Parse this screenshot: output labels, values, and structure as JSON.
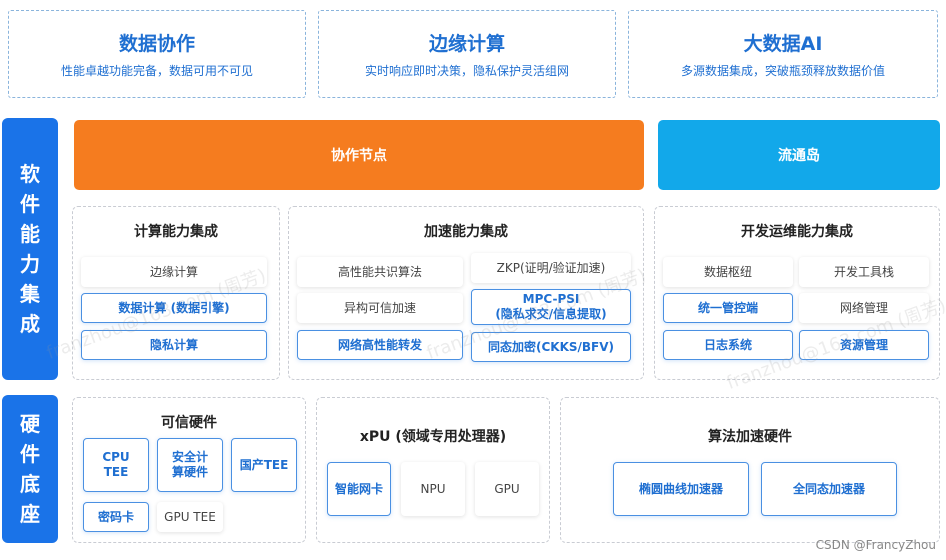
{
  "top": [
    {
      "title": "数据协作",
      "subtitle": "性能卓越功能完备，数据可用不可见"
    },
    {
      "title": "边缘计算",
      "subtitle": "实时响应即时决策，隐私保护灵活组网"
    },
    {
      "title": "大数据AI",
      "subtitle": "多源数据集成，突破瓶颈释放数据价值"
    }
  ],
  "sidebar": {
    "software": "软件能力集成",
    "hardware": "硬件底座"
  },
  "bars": {
    "node": "协作节点",
    "island": "流通岛"
  },
  "compute": {
    "title": "计算能力集成",
    "items": [
      "边缘计算",
      "数据计算 (数据引擎)",
      "隐私计算"
    ]
  },
  "accel": {
    "title": "加速能力集成",
    "left": [
      "高性能共识算法",
      "异构可信加速",
      "网络高性能转发"
    ],
    "zkp": "ZKP(证明/验证加速)",
    "mpc1": "MPC-PSI",
    "mpc2": "(隐私求交/信息提取)",
    "he": "同态加密(CKKS/BFV)"
  },
  "devops": {
    "title": "开发运维能力集成",
    "items": [
      "数据枢纽",
      "开发工具栈",
      "统一管控端",
      "网络管理",
      "日志系统",
      "资源管理"
    ]
  },
  "trusted": {
    "title": "可信硬件",
    "cpu1": "CPU",
    "cpu2": "TEE",
    "sec1": "安全计",
    "sec2": "算硬件",
    "domestic": "国产TEE",
    "crypto": "密码卡",
    "gpu_tee": "GPU TEE"
  },
  "xpu": {
    "title": "xPU (领域专用处理器)",
    "items": [
      "智能网卡",
      "NPU",
      "GPU"
    ]
  },
  "algo": {
    "title": "算法加速硬件",
    "items": [
      "椭圆曲线加速器",
      "全同态加速器"
    ]
  },
  "watermark": "franzhou@163.com (周芳)",
  "credit": "CSDN @FrancyZhou",
  "colors": {
    "blue": "#1a73e8",
    "orange": "#f57c1f",
    "cyan": "#12a8ea"
  }
}
